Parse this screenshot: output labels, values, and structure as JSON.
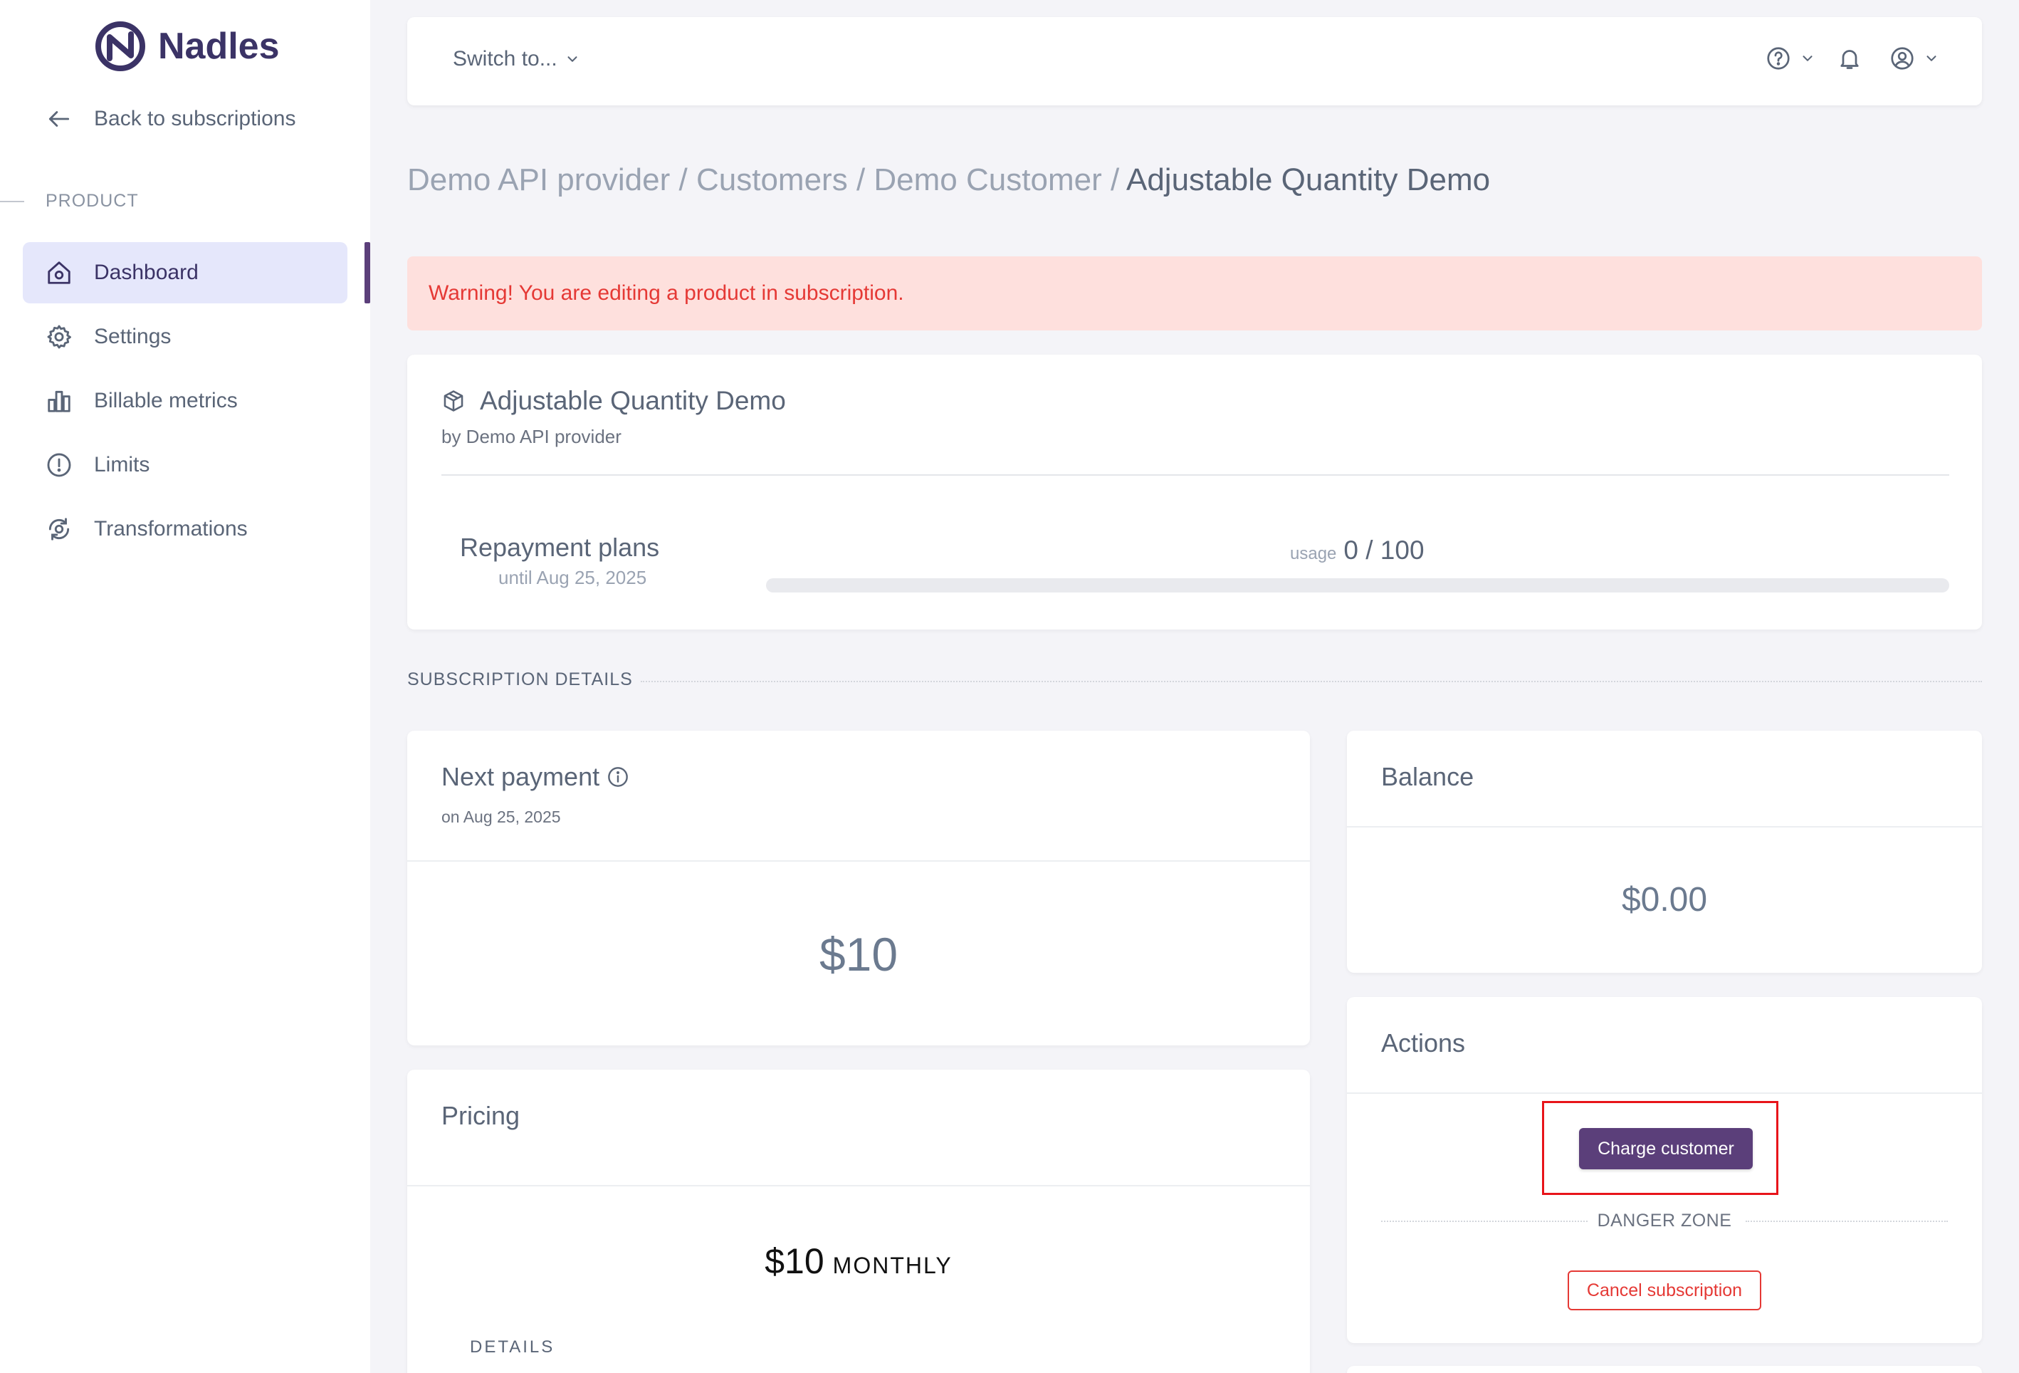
{
  "brand": {
    "name": "Nadles"
  },
  "sidebar": {
    "back_label": "Back to subscriptions",
    "section_label": "PRODUCT",
    "items": [
      {
        "label": "Dashboard",
        "icon": "home-icon",
        "active": true
      },
      {
        "label": "Settings",
        "icon": "gear-icon",
        "active": false
      },
      {
        "label": "Billable metrics",
        "icon": "bar-chart-icon",
        "active": false
      },
      {
        "label": "Limits",
        "icon": "alert-circle-icon",
        "active": false
      },
      {
        "label": "Transformations",
        "icon": "refresh-icon",
        "active": false
      }
    ]
  },
  "topbar": {
    "switch_label": "Switch to...",
    "icons": [
      "help-icon",
      "bell-icon",
      "user-icon"
    ]
  },
  "breadcrumb": {
    "items": [
      "Demo API provider",
      "Customers",
      "Demo Customer"
    ],
    "current": "Adjustable Quantity Demo",
    "separator": "/"
  },
  "warning": {
    "text": "Warning! You are editing a product in subscription."
  },
  "product": {
    "name": "Adjustable Quantity Demo",
    "by": "by Demo API provider",
    "plan_name": "Repayment plans",
    "plan_until": "until Aug 25, 2025",
    "usage_label": "usage",
    "usage_value": "0 / 100",
    "usage_fraction": 0
  },
  "subscription_details_label": "SUBSCRIPTION DETAILS",
  "next_payment": {
    "title": "Next payment",
    "date": "on Aug 25, 2025",
    "amount": "$10"
  },
  "balance": {
    "title": "Balance",
    "amount": "$0.00"
  },
  "actions": {
    "title": "Actions",
    "charge_label": "Charge customer",
    "danger_label": "DANGER ZONE",
    "cancel_label": "Cancel subscription"
  },
  "pricing": {
    "title": "Pricing",
    "amount": "$10",
    "period": "MONTHLY",
    "details_label": "DETAILS"
  },
  "colors": {
    "accent": "#5b3f7a",
    "warning_bg": "#fee0dd",
    "warning_text": "#e53935",
    "active_nav_bg": "#e5e7fb",
    "highlight": "#e8141a"
  }
}
